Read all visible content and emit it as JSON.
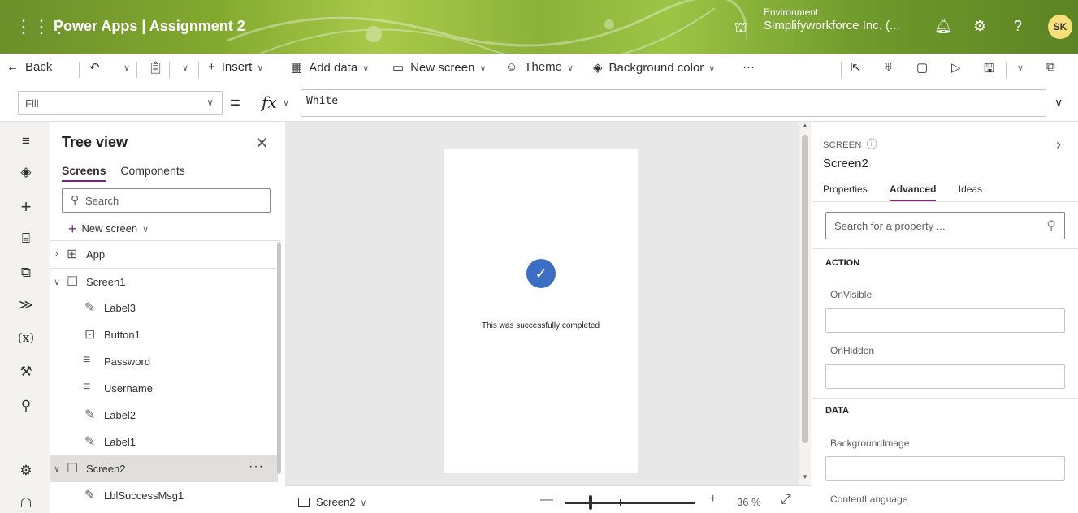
{
  "header": {
    "app_title": "Power Apps  |  Assignment 2",
    "env_label": "Environment",
    "env_name": "Simplifyworkforce Inc. (...",
    "avatar_initials": "SK",
    "gradient_color": "#82a92f"
  },
  "command_bar": {
    "back": "Back",
    "insert": "Insert",
    "add_data": "Add data",
    "new_screen": "New screen",
    "theme": "Theme",
    "background_color": "Background color",
    "more": "···"
  },
  "formula_bar": {
    "property": "Fill",
    "fx": "fx",
    "formula": "White"
  },
  "tree": {
    "title": "Tree view",
    "tabs": [
      "Screens",
      "Components"
    ],
    "search_placeholder": "Search",
    "new_screen": "New screen",
    "items": [
      {
        "label": "App"
      },
      {
        "label": "Screen1"
      },
      {
        "label": "Label3"
      },
      {
        "label": "Button1"
      },
      {
        "label": "Password"
      },
      {
        "label": "Username"
      },
      {
        "label": "Label2"
      },
      {
        "label": "Label1"
      },
      {
        "label": "Screen2"
      },
      {
        "label": "LblSuccessMsg1"
      }
    ],
    "more": "···"
  },
  "canvas": {
    "success_message": "This was successfully completed",
    "check_color": "#3c6ec4"
  },
  "status_bar": {
    "screen": "Screen2",
    "zoom": "36 %"
  },
  "properties": {
    "type": "SCREEN",
    "name": "Screen2",
    "tabs": [
      "Properties",
      "Advanced",
      "Ideas"
    ],
    "search_placeholder": "Search for a property ...",
    "sections": {
      "action": "ACTION",
      "data": "DATA"
    },
    "fields": {
      "on_visible": "OnVisible",
      "on_hidden": "OnHidden",
      "background_image": "BackgroundImage",
      "content_language": "ContentLanguage"
    },
    "accent_color": "#742774"
  }
}
